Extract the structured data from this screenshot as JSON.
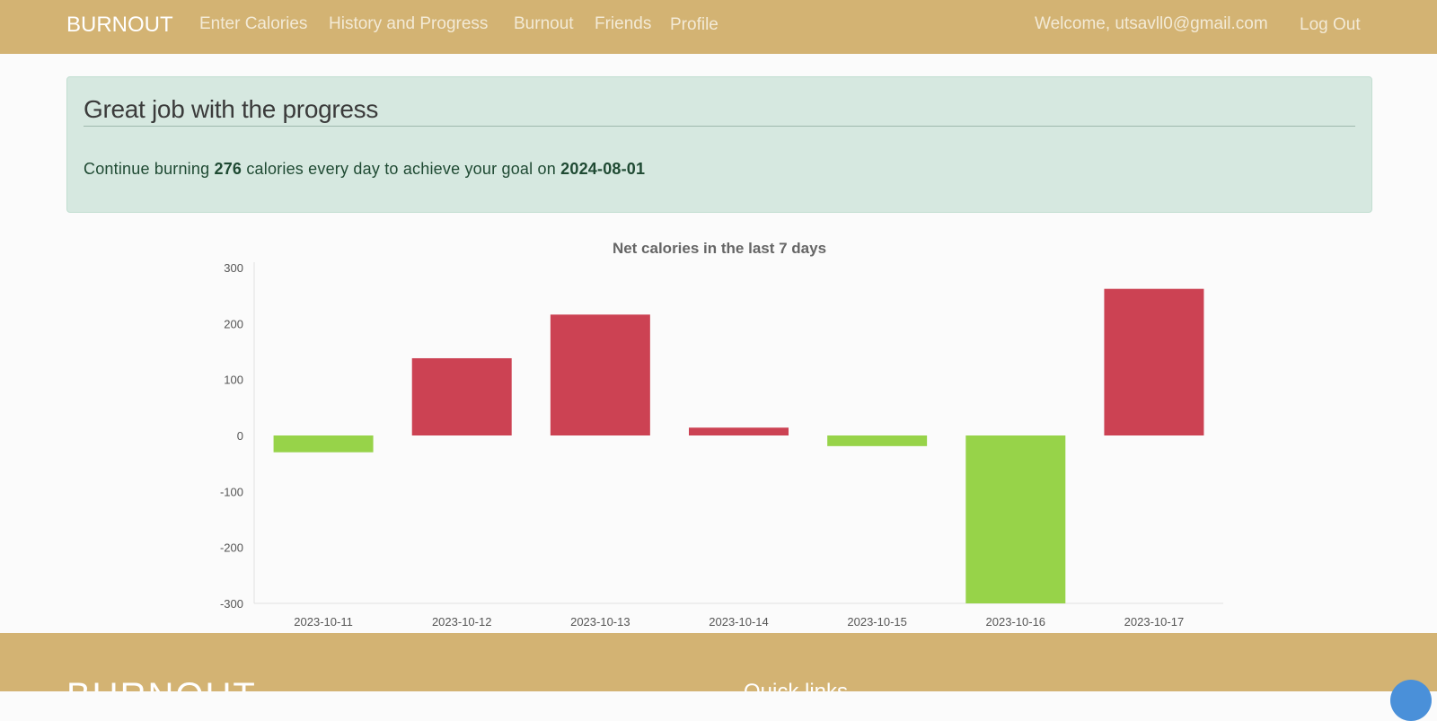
{
  "nav": {
    "brand": "BURNOUT",
    "links": [
      "Enter Calories",
      "History and Progress",
      "Burnout",
      "Friends",
      "Profile"
    ],
    "welcome": "Welcome, utsavll0@gmail.com",
    "logout": "Log Out"
  },
  "alert": {
    "title": "Great job with the progress",
    "text_before": "Continue burning ",
    "calories": "276",
    "text_middle": " calories every day to achieve your goal on ",
    "goal_date": "2024-08-01"
  },
  "chart_data": {
    "type": "bar",
    "title": "Net calories in the last 7 days",
    "categories": [
      "2023-10-11",
      "2023-10-12",
      "2023-10-13",
      "2023-10-14",
      "2023-10-15",
      "2023-10-16",
      "2023-10-17"
    ],
    "values": [
      -30,
      138,
      216,
      14,
      -19,
      -300,
      262
    ],
    "ylim": [
      -300,
      300
    ],
    "yticks": [
      300,
      200,
      100,
      0,
      -100,
      -200,
      -300
    ],
    "colors": {
      "positive": "#cc4253",
      "negative": "#97d349"
    },
    "xlabel": "",
    "ylabel": ""
  },
  "footer": {
    "brand": "BURNOUT",
    "quick_links_title": "Quick links"
  },
  "colors": {
    "nav_bg": "#d3b373",
    "alert_bg": "#d6e8e0"
  }
}
